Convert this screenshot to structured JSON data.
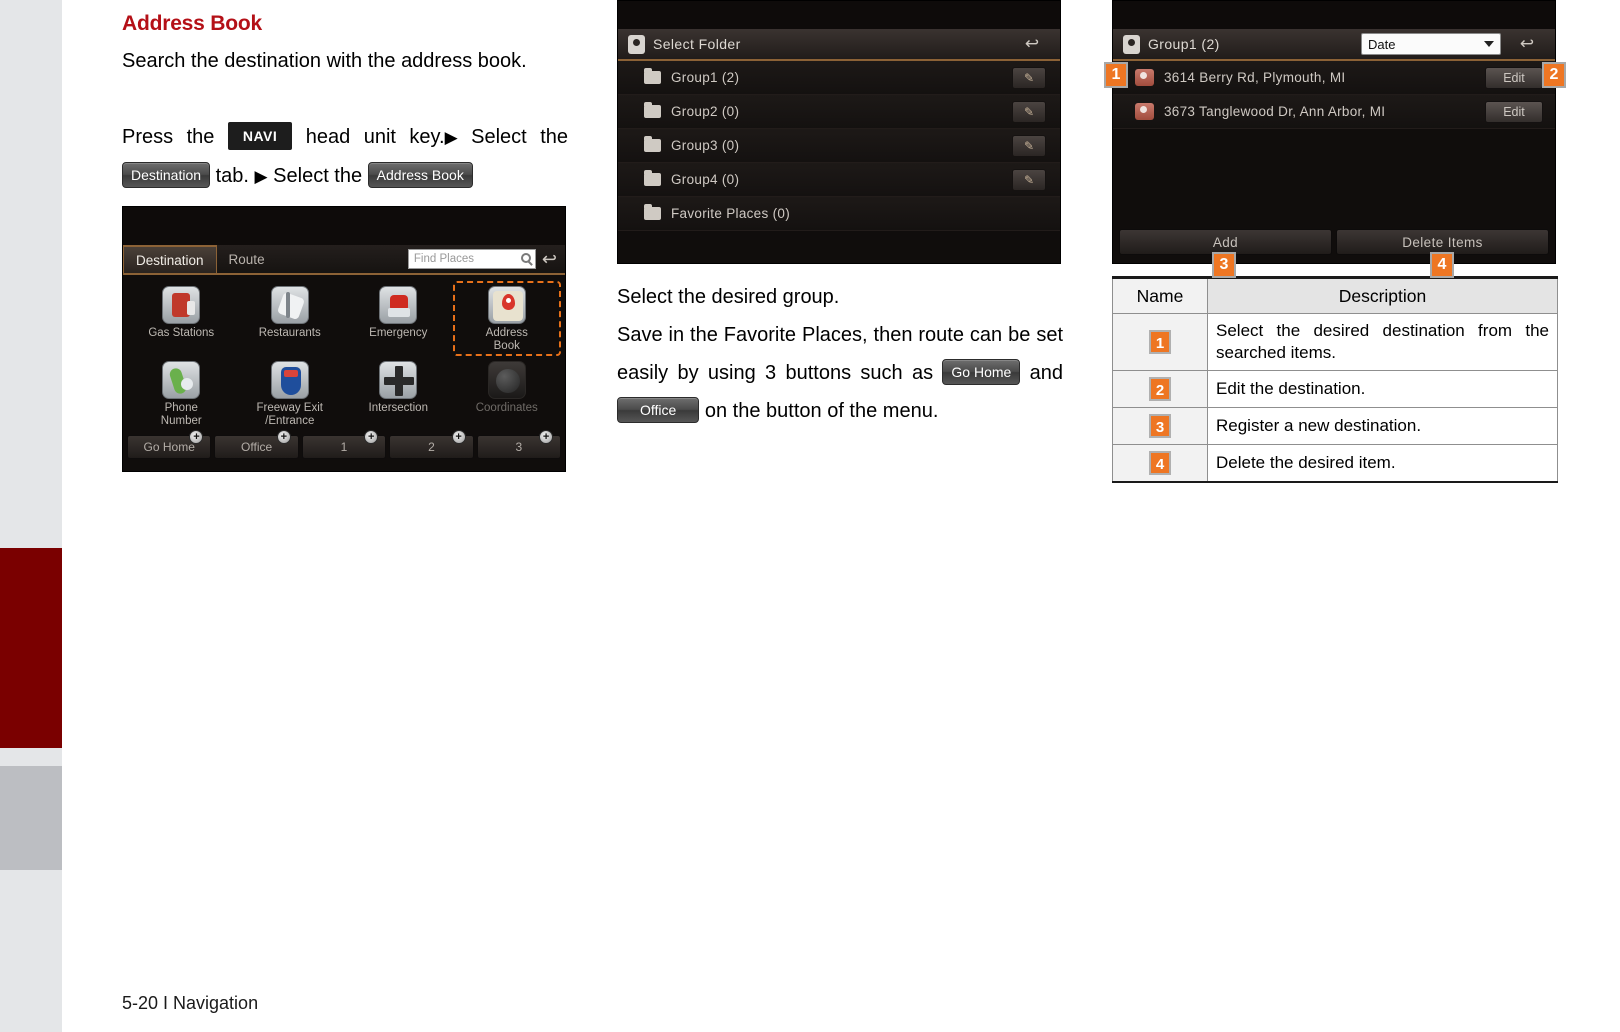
{
  "sidebar": {
    "bands": [
      {
        "name": "band-light-top",
        "color": "#e4e6e8"
      },
      {
        "name": "band-red",
        "color": "#7a0000"
      },
      {
        "name": "band-gray",
        "color": "#bcbec2"
      },
      {
        "name": "band-light-bottom",
        "color": "#e4e6e8"
      }
    ]
  },
  "accent_color": "#ee7623",
  "heading_color": "#b41017",
  "col1": {
    "heading": "Address Book",
    "intro": "Search the destination with the address book.",
    "steps": {
      "t1": "Press the ",
      "chip_navi": "NAVI",
      "t2": " head unit key.",
      "arrow": "▶",
      "t3": " Select the ",
      "chip_destination": "Destination",
      "t4": " tab. ",
      "t5": " Select the ",
      "chip_addressbook": "Address Book"
    },
    "destination_screen": {
      "tabs": [
        {
          "label": "Destination",
          "active": true
        },
        {
          "label": "Route",
          "active": false
        }
      ],
      "search_placeholder": "Find Places",
      "search_icon": "search-icon",
      "back_icon": "back-arrow-icon",
      "items": [
        {
          "label": "Gas Stations",
          "icon": "gas-station-icon",
          "selected": false,
          "dim": false
        },
        {
          "label": "Restaurants",
          "icon": "restaurant-icon",
          "selected": false,
          "dim": false
        },
        {
          "label": "Emergency",
          "icon": "emergency-icon",
          "selected": false,
          "dim": false
        },
        {
          "label": "Address\nBook",
          "icon": "address-book-icon",
          "selected": true,
          "dim": false
        },
        {
          "label": "Phone\nNumber",
          "icon": "phone-icon",
          "selected": false,
          "dim": false
        },
        {
          "label": "Freeway Exit\n/Entrance",
          "icon": "freeway-icon",
          "selected": false,
          "dim": false
        },
        {
          "label": "Intersection",
          "icon": "intersection-icon",
          "selected": false,
          "dim": false
        },
        {
          "label": "Coordinates",
          "icon": "coordinates-icon",
          "selected": false,
          "dim": true
        }
      ],
      "shortcuts": [
        {
          "label": "Go Home"
        },
        {
          "label": "Office"
        },
        {
          "label": "1"
        },
        {
          "label": "2"
        },
        {
          "label": "3"
        }
      ],
      "shortcut_add_icon": "plus-icon"
    }
  },
  "col2": {
    "select_folder_screen": {
      "title": "Select Folder",
      "title_icon": "pin-icon",
      "back_icon": "back-arrow-icon",
      "edit_icon": "pencil-icon",
      "folders": [
        {
          "label": "Group1 (2)",
          "has_edit": true
        },
        {
          "label": "Group2 (0)",
          "has_edit": true
        },
        {
          "label": "Group3 (0)",
          "has_edit": true
        },
        {
          "label": "Group4 (0)",
          "has_edit": true
        },
        {
          "label": "Favorite Places (0)",
          "has_edit": false
        }
      ]
    },
    "para1": "Select the desired group.",
    "para2": {
      "t1": "Save in the Favorite Places, then route can be set easily by using 3 buttons such as ",
      "chip_gohome": "Go Home",
      "t2": " and ",
      "chip_office": "Office",
      "t3": " on the button of the menu."
    }
  },
  "col3": {
    "group_screen": {
      "title": "Group1 (2)",
      "title_icon": "pin-icon",
      "sort_value": "Date",
      "sort_icon": "chevron-down-icon",
      "back_icon": "back-arrow-icon",
      "entries": [
        {
          "label": "3614 Berry Rd, Plymouth, MI",
          "edit_label": "Edit",
          "icon": "poi-icon"
        },
        {
          "label": "3673 Tanglewood Dr, Ann Arbor, MI",
          "edit_label": "Edit",
          "icon": "poi-icon"
        }
      ],
      "buttons": [
        {
          "label": "Add"
        },
        {
          "label": "Delete Items"
        }
      ],
      "callouts": [
        "1",
        "2",
        "3",
        "4"
      ]
    },
    "table": {
      "headers": [
        "Name",
        "Description"
      ],
      "rows": [
        {
          "name": "1",
          "description": "Select the desired destination from the searched items."
        },
        {
          "name": "2",
          "description": "Edit the destination."
        },
        {
          "name": "3",
          "description": "Register a new destination."
        },
        {
          "name": "4",
          "description": "Delete the desired item."
        }
      ]
    }
  },
  "footer": {
    "text": "5-20 I Navigation"
  }
}
